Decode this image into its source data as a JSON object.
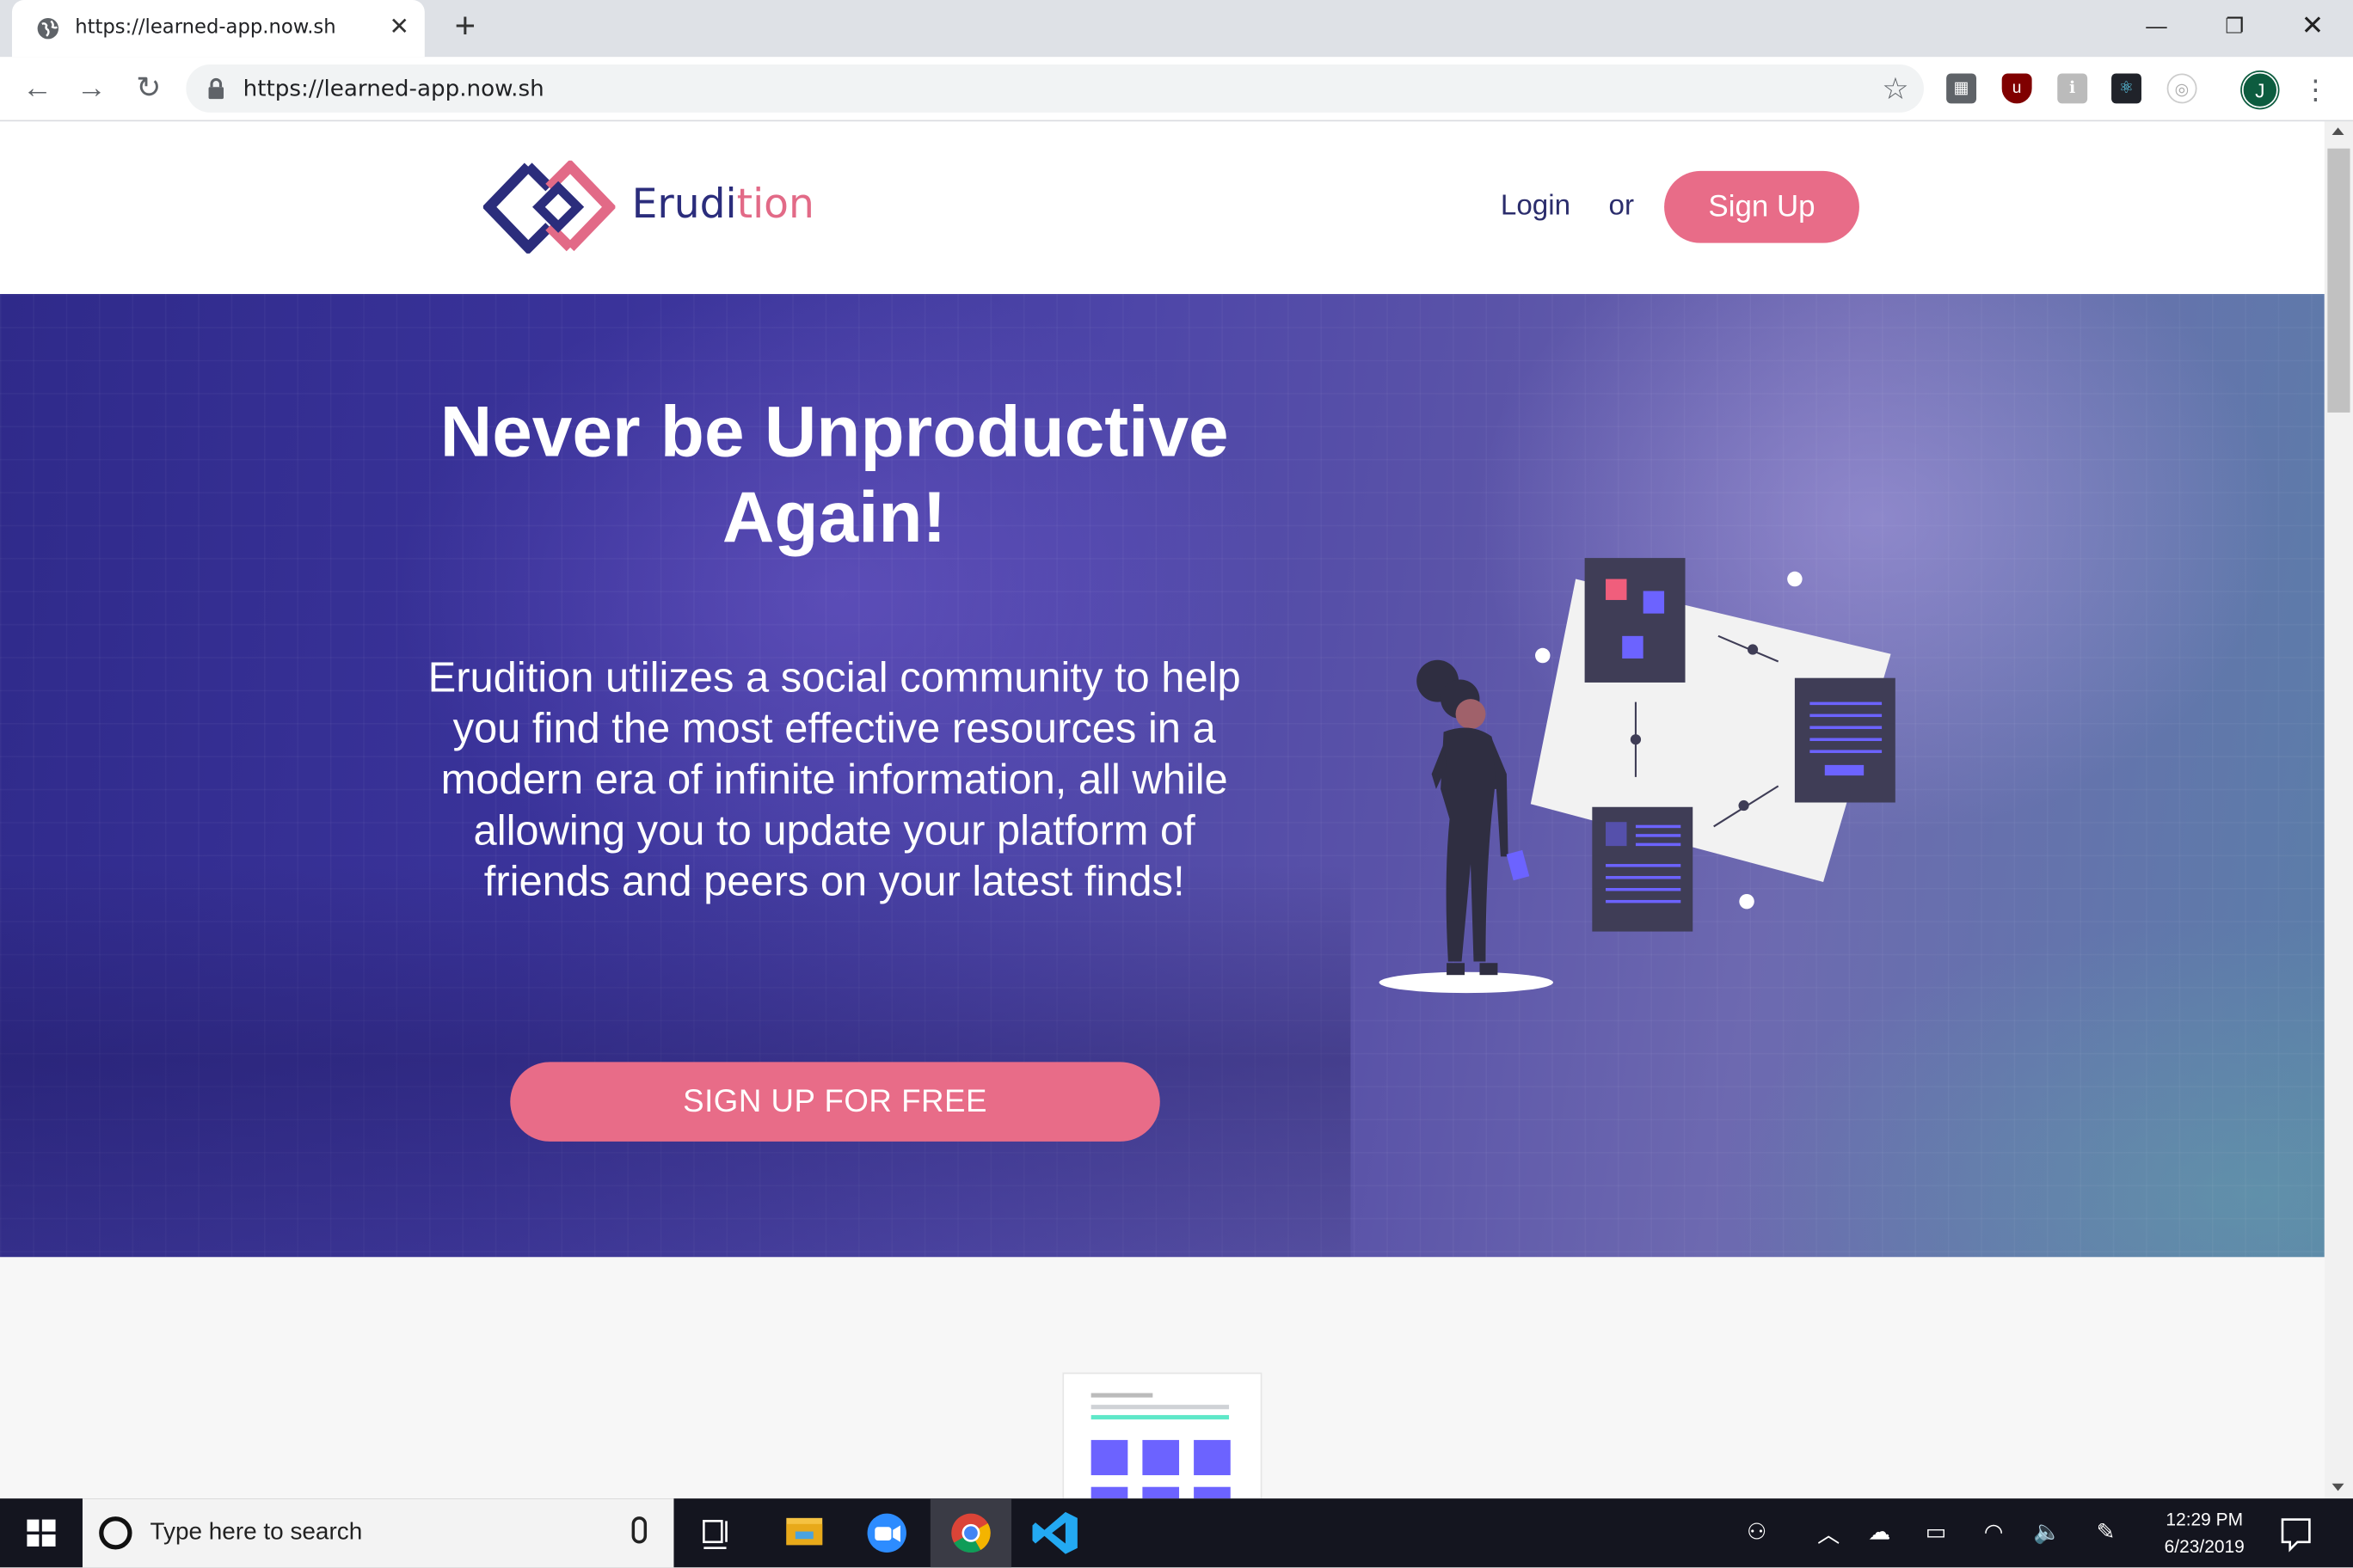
{
  "browser": {
    "tab_title": "https://learned-app.now.sh",
    "url": "https://learned-app.now.sh",
    "new_tab_symbol": "+",
    "profile_initial": "J"
  },
  "site": {
    "brand_part1": "Erudi",
    "brand_part2": "tion",
    "nav": {
      "login": "Login",
      "or": "or",
      "signup": "Sign Up"
    },
    "hero": {
      "title": "Never be Unproductive Again!",
      "description": "Erudition utilizes a social community to help you find the most effective resources in a modern era of infinite information, all while allowing you to update your platform of friends and peers on your latest finds!",
      "cta": "SIGN UP FOR FREE"
    }
  },
  "taskbar": {
    "search_placeholder": "Type here to search",
    "time": "12:29 PM",
    "date": "6/23/2019"
  },
  "colors": {
    "accent_pink": "#e86c88",
    "brand_navy": "#2b2d7c",
    "hero_start": "#2f2a8a",
    "hero_end": "#5a7fa8"
  }
}
